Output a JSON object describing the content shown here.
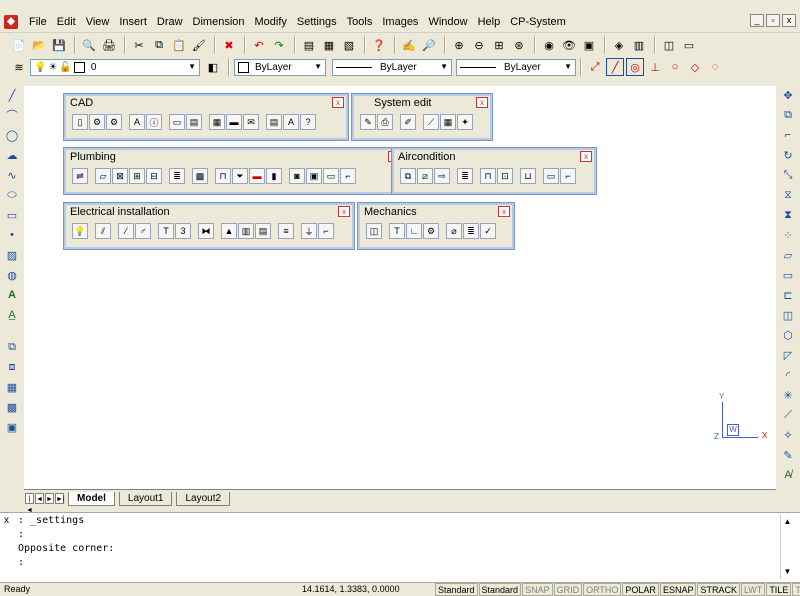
{
  "menu": [
    "File",
    "Edit",
    "View",
    "Insert",
    "Draw",
    "Dimension",
    "Modify",
    "Settings",
    "Tools",
    "Images",
    "Window",
    "Help",
    "CP-System"
  ],
  "window_buttons": [
    "_",
    "▫",
    "x"
  ],
  "properties": {
    "layer_value": "0",
    "color_value": "ByLayer",
    "linetype_value": "ByLayer",
    "lineweight_value": "ByLayer"
  },
  "toolbars": {
    "cad": "CAD",
    "system_edit": "System edit",
    "plumbing": "Plumbing",
    "aircondition": "Aircondition",
    "electrical": "Electrical installation",
    "mechanics": "Mechanics"
  },
  "close_glyph": "x",
  "ucs": {
    "x": "X",
    "y": "Y",
    "w": "W",
    "z": "Z"
  },
  "tabs": {
    "model": "Model",
    "layout1": "Layout1",
    "layout2": "Layout2"
  },
  "tab_nav": [
    "|◄",
    "◄",
    "►",
    "►|"
  ],
  "command_lines": [
    ": _settings",
    ":",
    "Opposite corner:",
    ":"
  ],
  "status": {
    "ready": "Ready",
    "coords": "14.1614, 1.3383, 0.0000",
    "modes": [
      {
        "label": "Standard",
        "on": true
      },
      {
        "label": "Standard",
        "on": true
      },
      {
        "label": "SNAP",
        "on": false
      },
      {
        "label": "GRID",
        "on": false
      },
      {
        "label": "ORTHO",
        "on": false
      },
      {
        "label": "POLAR",
        "on": true
      },
      {
        "label": "ESNAP",
        "on": true
      },
      {
        "label": "STRACK",
        "on": true
      },
      {
        "label": "LWT",
        "on": false
      },
      {
        "label": "TILE",
        "on": true
      },
      {
        "label": "TABLET",
        "on": false
      }
    ]
  },
  "colors": {
    "accent": "#1a4fa0",
    "close_red": "#cc3333",
    "toolbar_border": "#7a96c2"
  }
}
